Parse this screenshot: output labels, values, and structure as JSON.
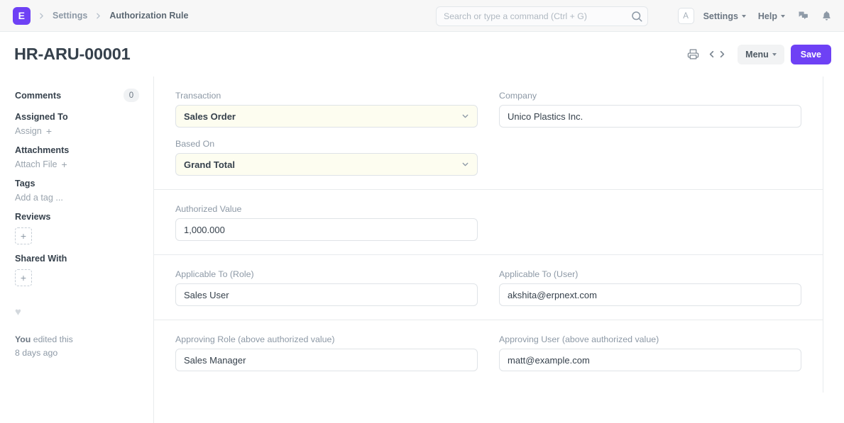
{
  "navbar": {
    "logo_letter": "E",
    "breadcrumbs": [
      {
        "label": "Settings",
        "active": false
      },
      {
        "label": "Authorization Rule",
        "active": true
      }
    ],
    "search": {
      "value": "",
      "placeholder": "Search or type a command (Ctrl + G)"
    },
    "avatar_letter": "A",
    "settings_label": "Settings",
    "help_label": "Help"
  },
  "page": {
    "title": "HR-ARU-00001",
    "menu_label": "Menu",
    "save_label": "Save"
  },
  "sidebar": {
    "comments_label": "Comments",
    "comments_count": "0",
    "assigned_to_label": "Assigned To",
    "assign_label": "Assign",
    "attachments_label": "Attachments",
    "attach_file_label": "Attach File",
    "tags_label": "Tags",
    "add_tag_label": "Add a tag ...",
    "reviews_label": "Reviews",
    "shared_with_label": "Shared With",
    "plus_glyph": "+",
    "heart_glyph": "♥",
    "footer_actor": "You",
    "footer_action": " edited this",
    "footer_time": "8 days ago"
  },
  "form": {
    "transaction": {
      "label": "Transaction",
      "value": "Sales Order"
    },
    "company": {
      "label": "Company",
      "value": "Unico Plastics Inc."
    },
    "based_on": {
      "label": "Based On",
      "value": "Grand Total"
    },
    "authorized_value": {
      "label": "Authorized Value",
      "value": "1,000.000"
    },
    "applicable_role": {
      "label": "Applicable To (Role)",
      "value": "Sales User"
    },
    "applicable_user": {
      "label": "Applicable To (User)",
      "value": "akshita@erpnext.com"
    },
    "approving_role": {
      "label": "Approving Role (above authorized value)",
      "value": "Sales Manager"
    },
    "approving_user": {
      "label": "Approving User (above authorized value)",
      "value": "matt@example.com"
    }
  },
  "colors": {
    "brand_purple": "#6e41f5",
    "mandatory_field_bg": "#fdfdf0",
    "text_dark": "#36414c",
    "text_muted": "#8d99a6"
  }
}
